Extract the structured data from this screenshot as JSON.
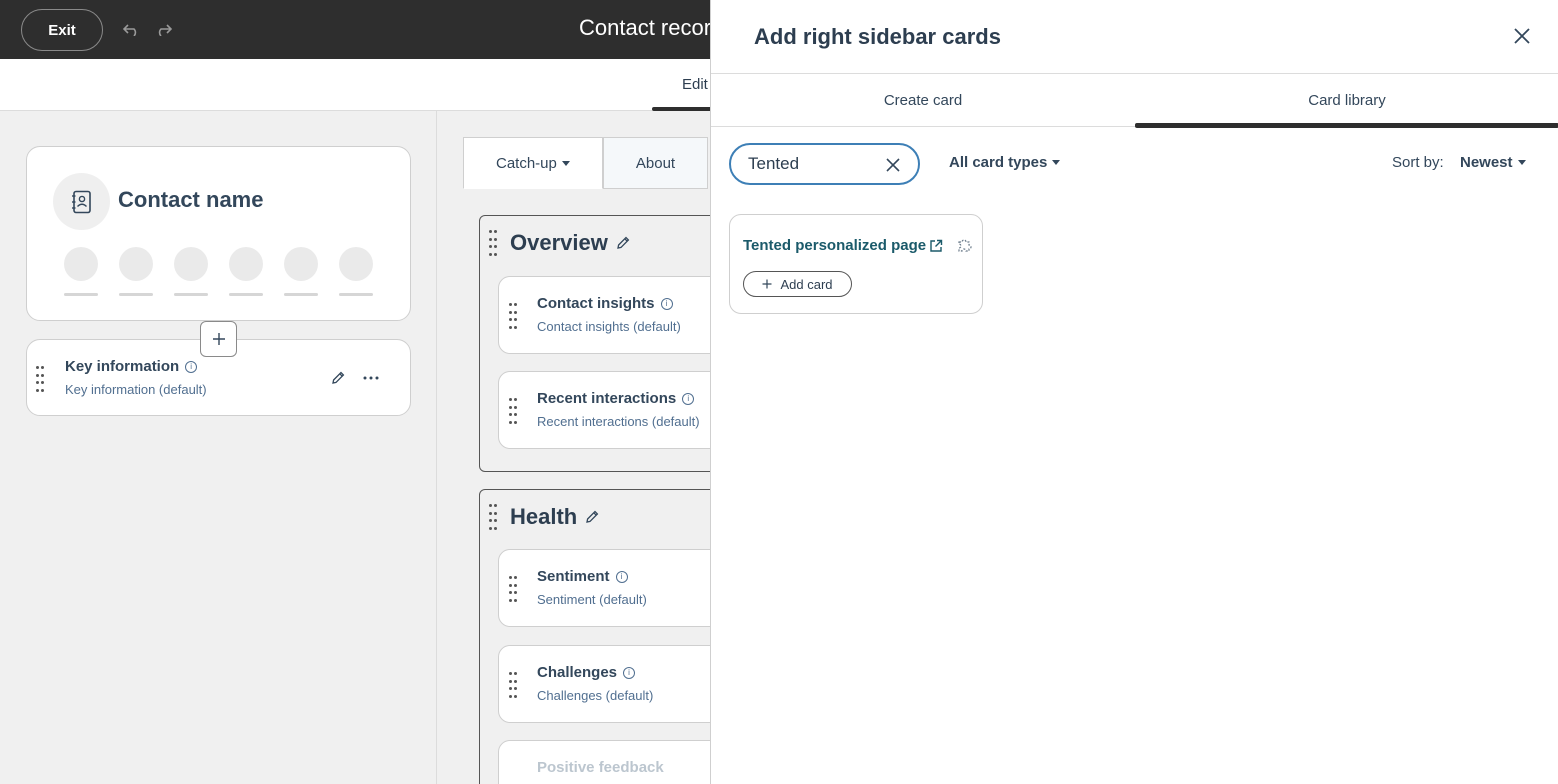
{
  "topbar": {
    "exit_label": "Exit",
    "title": "Contact recor"
  },
  "subheader": {
    "edit_tab": "Edit"
  },
  "left": {
    "contact_name": "Contact name",
    "key_info": {
      "title": "Key information",
      "subtitle": "Key information (default)"
    }
  },
  "middle": {
    "tabs": [
      {
        "label": "Catch-up"
      },
      {
        "label": "About"
      }
    ],
    "sections": [
      {
        "title": "Overview",
        "cards": [
          {
            "title": "Contact insights",
            "subtitle": "Contact insights (default)"
          },
          {
            "title": "Recent interactions",
            "subtitle": "Recent interactions (default)"
          }
        ]
      },
      {
        "title": "Health",
        "cards": [
          {
            "title": "Sentiment",
            "subtitle": "Sentiment (default)"
          },
          {
            "title": "Challenges",
            "subtitle": "Challenges (default)"
          }
        ]
      }
    ],
    "faded_card_title": "Positive feedback"
  },
  "panel": {
    "title": "Add right sidebar cards",
    "tabs": [
      {
        "label": "Create card",
        "active": false
      },
      {
        "label": "Card library",
        "active": true
      }
    ],
    "search": {
      "value": "Tented"
    },
    "type_filter": "All card types",
    "sort_label": "Sort by:",
    "sort_value": "Newest",
    "results": [
      {
        "title": "Tented personalized page",
        "add_label": "Add card"
      }
    ]
  },
  "colors": {
    "topbar_bg": "#2e2e2e",
    "accent_focus": "#3d7fb6",
    "link_teal": "#1b5a6a"
  }
}
